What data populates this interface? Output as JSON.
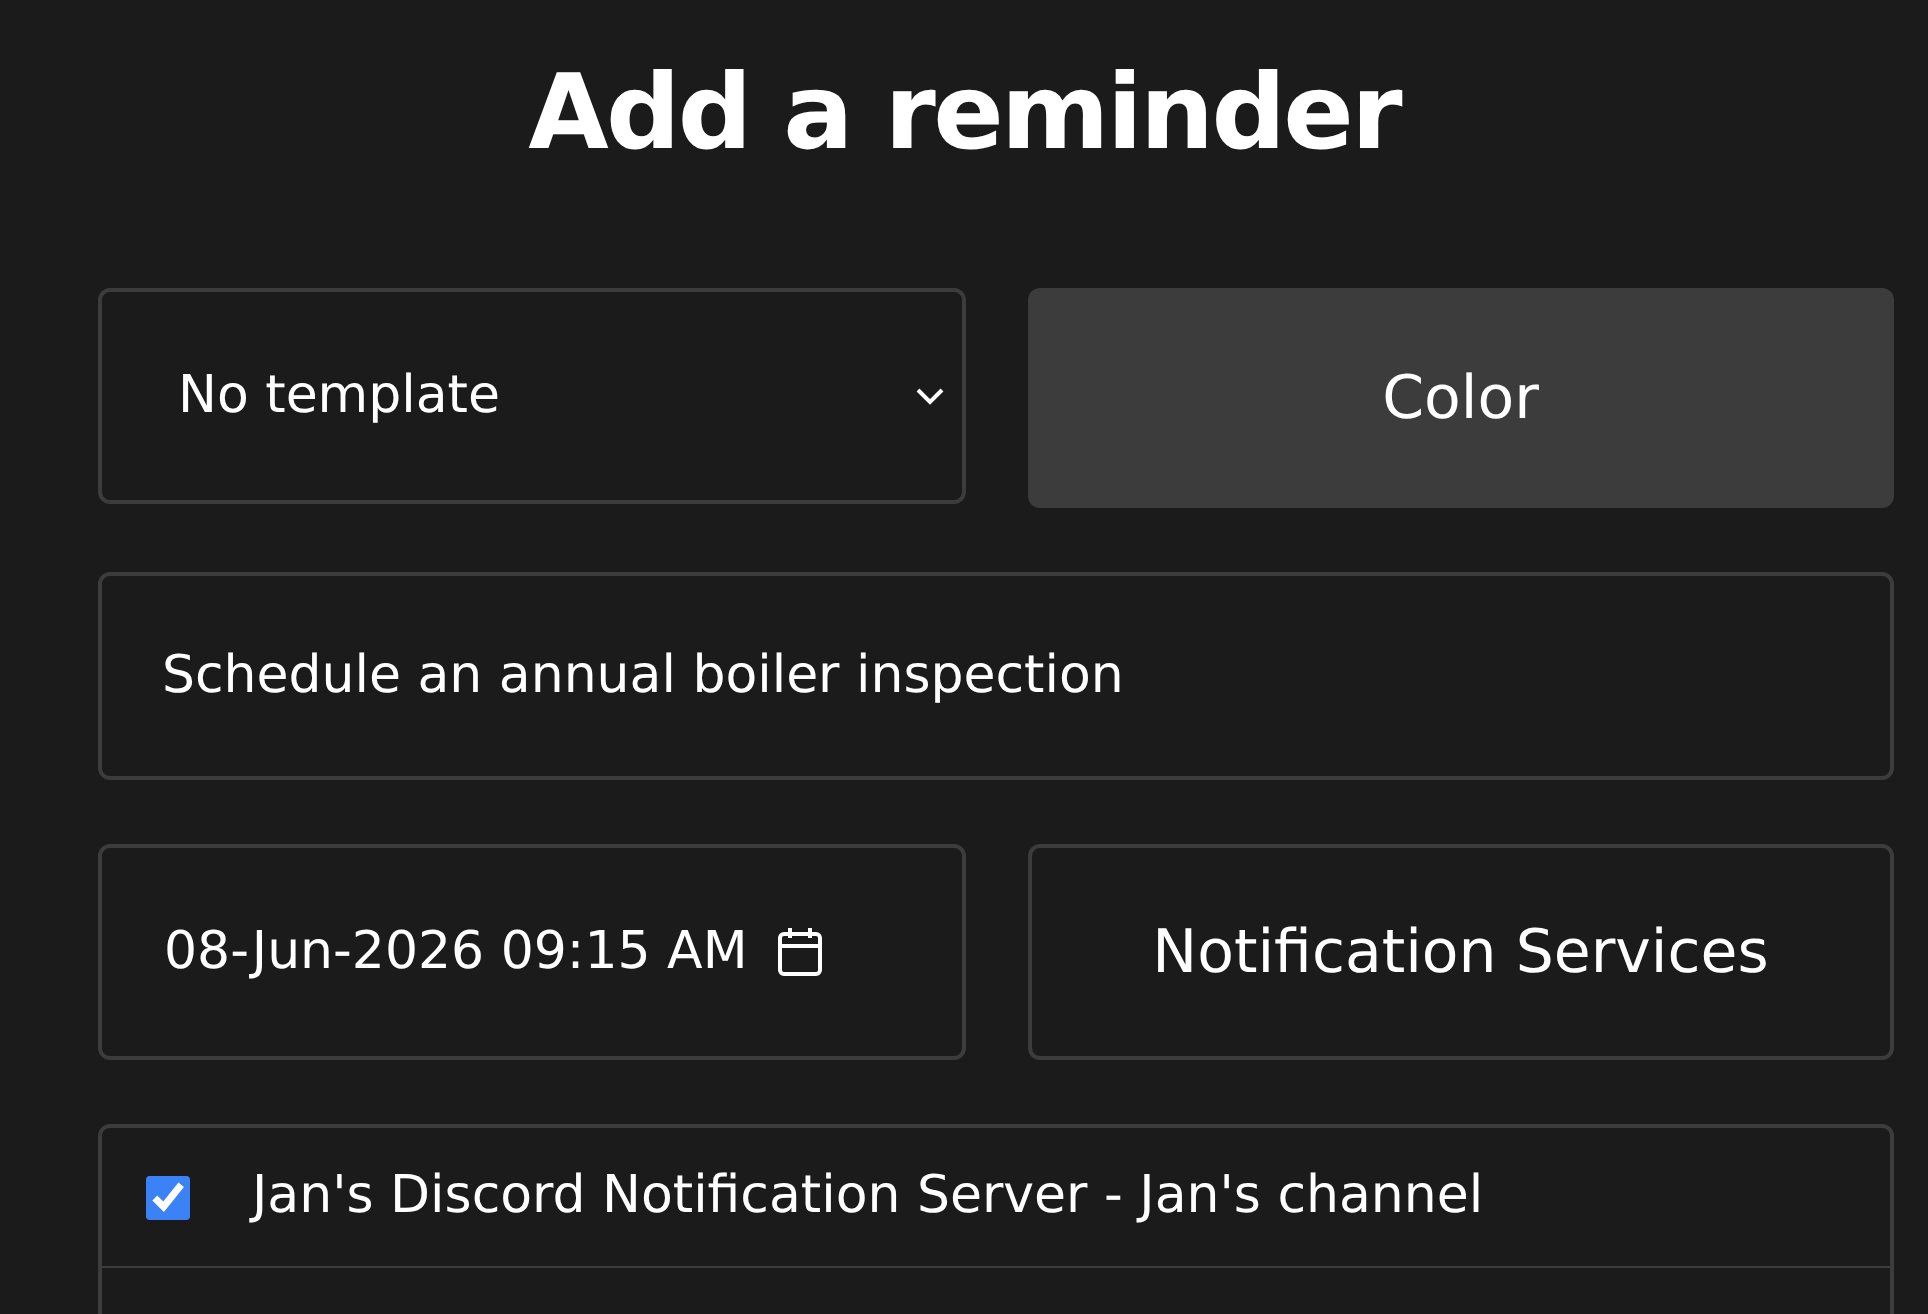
{
  "title": "Add a reminder",
  "template": {
    "value": "No template"
  },
  "color_button": {
    "label": "Color"
  },
  "reminder_text": {
    "value": "Schedule an annual boiler inspection"
  },
  "datetime": {
    "value": "08-Jun-2026 09:15 AM"
  },
  "services_button": {
    "label": "Notification Services"
  },
  "services": [
    {
      "label": "Jan's Discord Notification Server - Jan's channel",
      "checked": true
    }
  ]
}
